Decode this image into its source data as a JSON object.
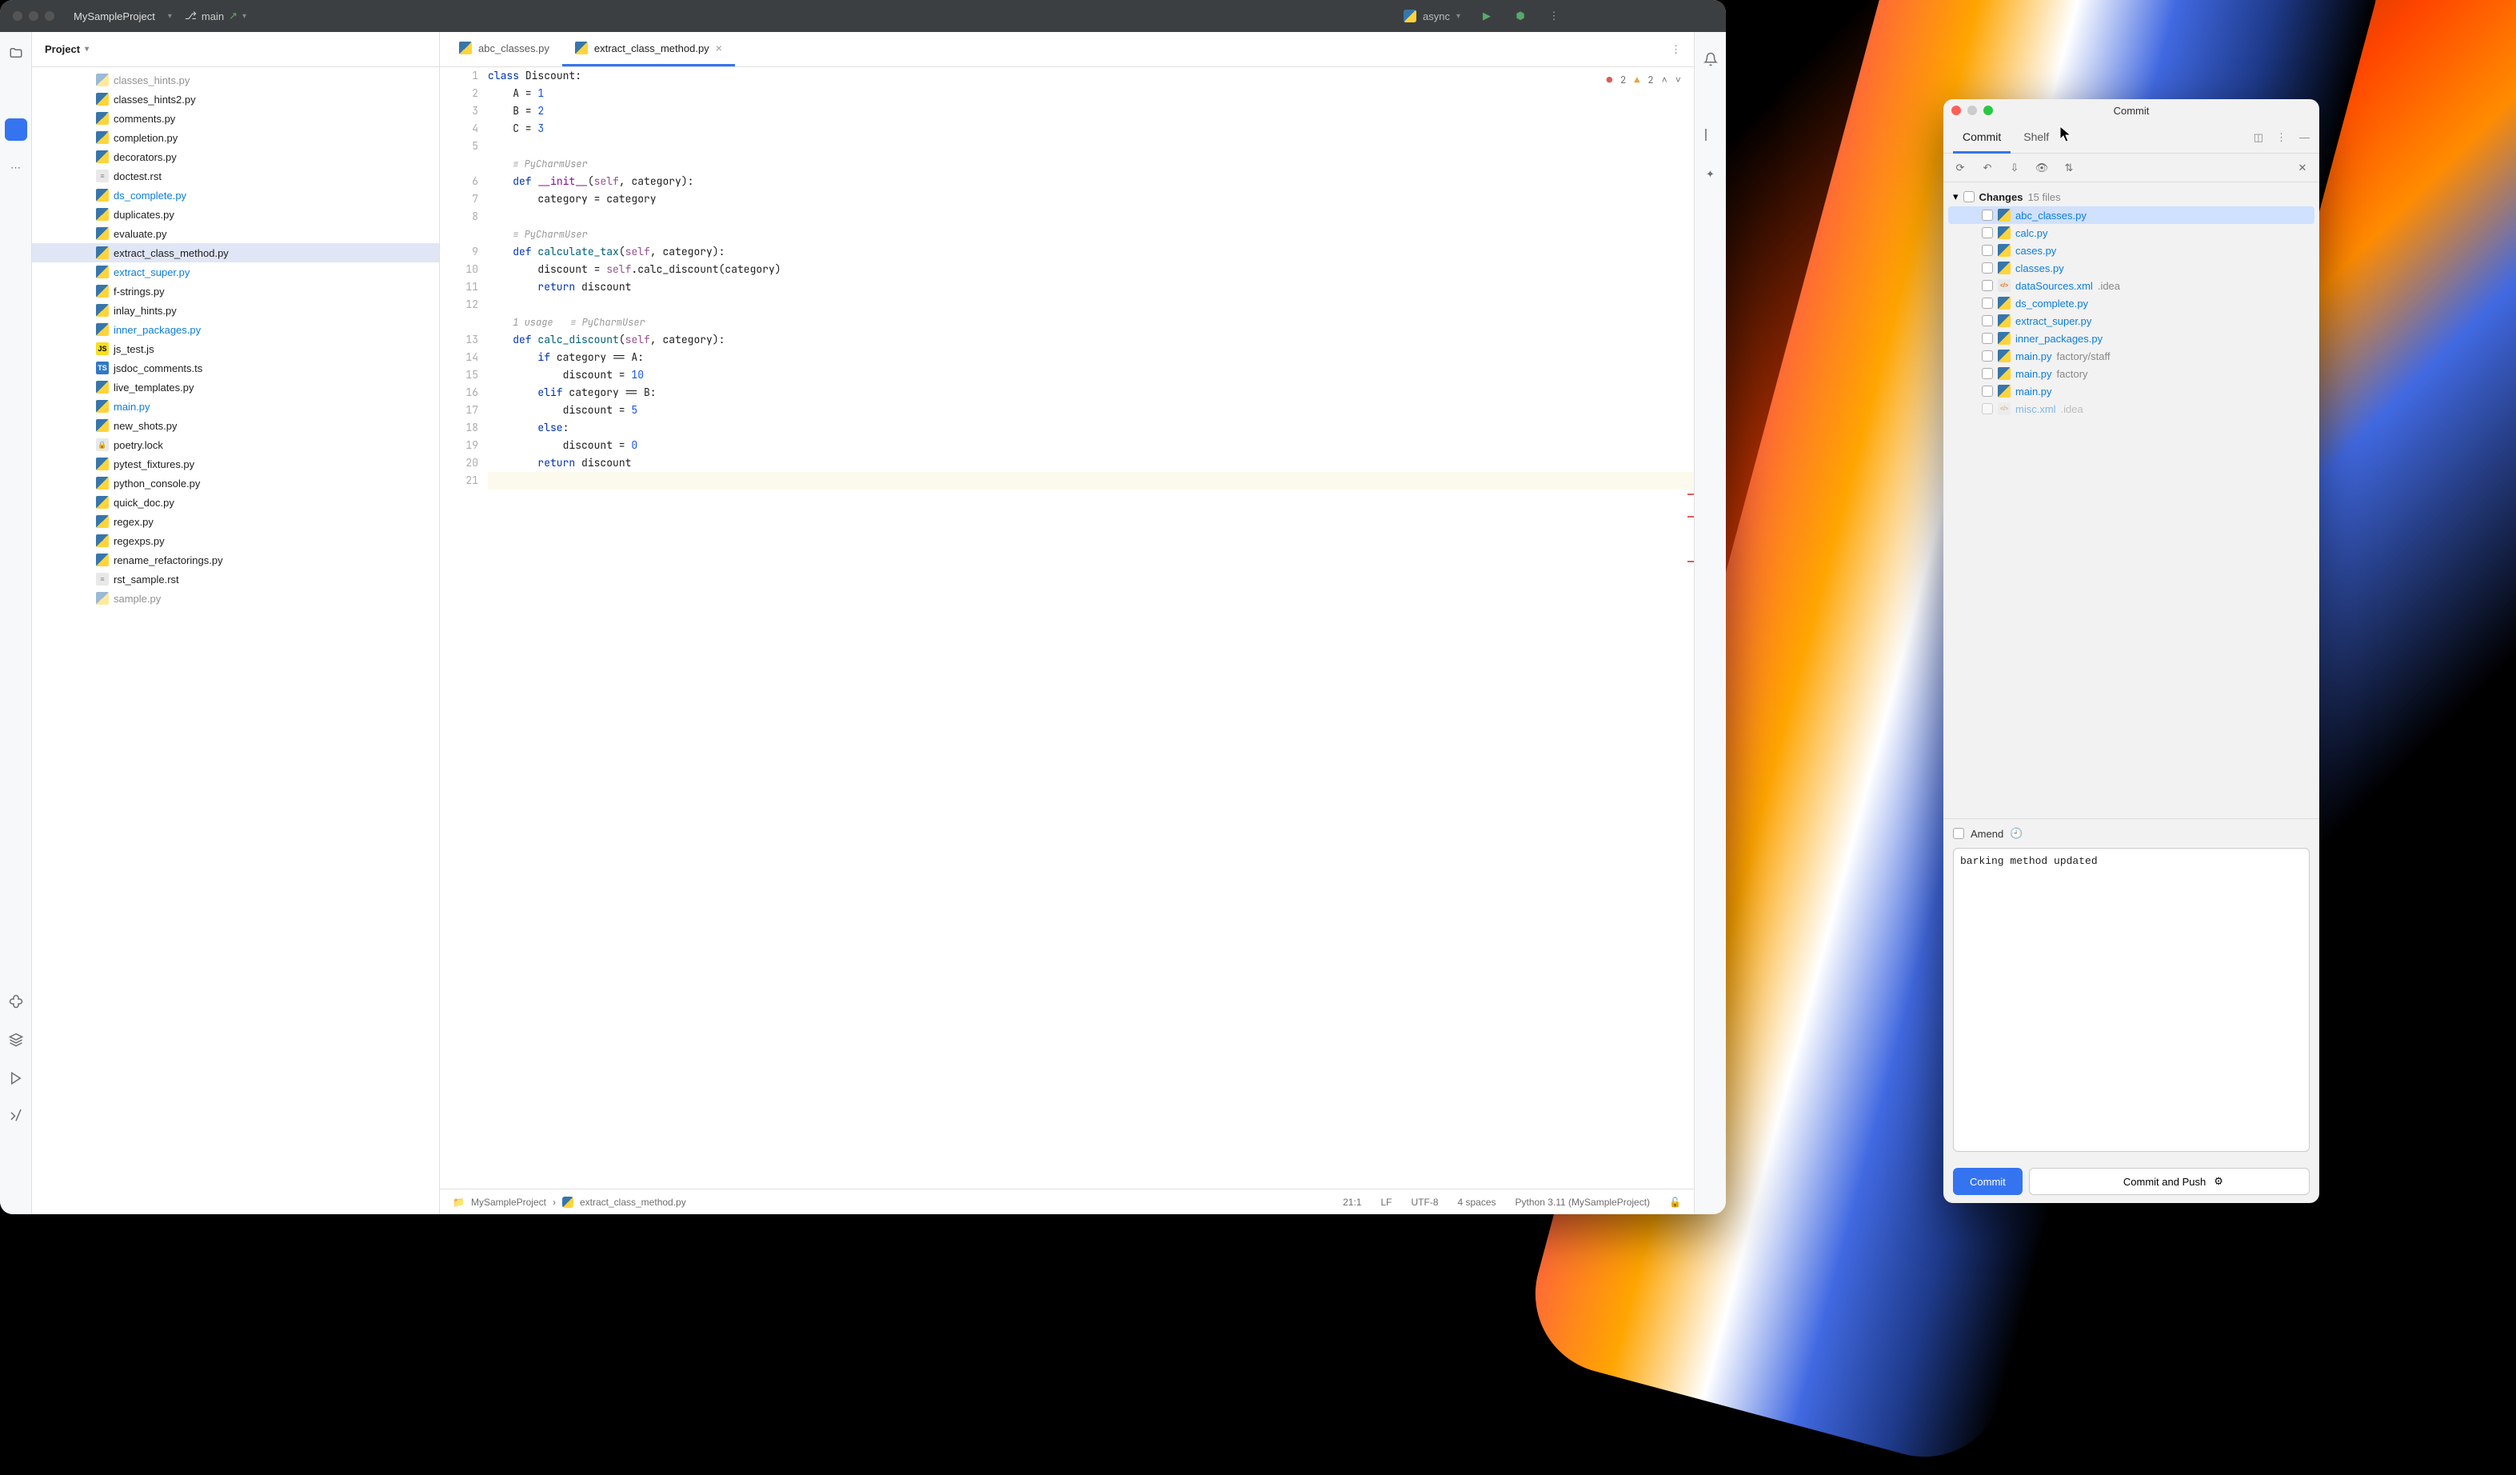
{
  "titlebar": {
    "project": "MySampleProject",
    "branch": "main",
    "run_config": "async"
  },
  "sidebar": {
    "title": "Project",
    "files": [
      {
        "n": "classes_hints.py",
        "icon": "py",
        "mod": false,
        "sel": false,
        "cut": true
      },
      {
        "n": "classes_hints2.py",
        "icon": "py",
        "mod": false,
        "sel": false
      },
      {
        "n": "comments.py",
        "icon": "py",
        "mod": false,
        "sel": false
      },
      {
        "n": "completion.py",
        "icon": "py",
        "mod": false,
        "sel": false
      },
      {
        "n": "decorators.py",
        "icon": "py",
        "mod": false,
        "sel": false
      },
      {
        "n": "doctest.rst",
        "icon": "rst",
        "mod": false,
        "sel": false
      },
      {
        "n": "ds_complete.py",
        "icon": "py",
        "mod": true,
        "sel": false
      },
      {
        "n": "duplicates.py",
        "icon": "py",
        "mod": false,
        "sel": false
      },
      {
        "n": "evaluate.py",
        "icon": "py",
        "mod": false,
        "sel": false
      },
      {
        "n": "extract_class_method.py",
        "icon": "py",
        "mod": false,
        "sel": true
      },
      {
        "n": "extract_super.py",
        "icon": "py",
        "mod": true,
        "sel": false
      },
      {
        "n": "f-strings.py",
        "icon": "py",
        "mod": false,
        "sel": false
      },
      {
        "n": "inlay_hints.py",
        "icon": "py",
        "mod": false,
        "sel": false
      },
      {
        "n": "inner_packages.py",
        "icon": "py",
        "mod": true,
        "sel": false
      },
      {
        "n": "js_test.js",
        "icon": "js",
        "mod": false,
        "sel": false
      },
      {
        "n": "jsdoc_comments.ts",
        "icon": "ts",
        "mod": false,
        "sel": false
      },
      {
        "n": "live_templates.py",
        "icon": "py",
        "mod": false,
        "sel": false
      },
      {
        "n": "main.py",
        "icon": "py",
        "mod": true,
        "sel": false
      },
      {
        "n": "new_shots.py",
        "icon": "py",
        "mod": false,
        "sel": false
      },
      {
        "n": "poetry.lock",
        "icon": "lock",
        "mod": false,
        "sel": false
      },
      {
        "n": "pytest_fixtures.py",
        "icon": "py",
        "mod": false,
        "sel": false
      },
      {
        "n": "python_console.py",
        "icon": "py",
        "mod": false,
        "sel": false
      },
      {
        "n": "quick_doc.py",
        "icon": "py",
        "mod": false,
        "sel": false
      },
      {
        "n": "regex.py",
        "icon": "py",
        "mod": false,
        "sel": false
      },
      {
        "n": "regexps.py",
        "icon": "py",
        "mod": false,
        "sel": false
      },
      {
        "n": "rename_refactorings.py",
        "icon": "py",
        "mod": false,
        "sel": false
      },
      {
        "n": "rst_sample.rst",
        "icon": "rst",
        "mod": false,
        "sel": false
      },
      {
        "n": "sample.py",
        "icon": "py",
        "mod": false,
        "sel": false,
        "cut": true
      }
    ]
  },
  "tabs": [
    {
      "label": "abc_classes.py",
      "active": false
    },
    {
      "label": "extract_class_method.py",
      "active": true
    }
  ],
  "problems": {
    "errors": "2",
    "warnings": "2"
  },
  "code": {
    "author": "PyCharmUser",
    "usages": "1 usage",
    "lines": [
      {
        "g": "1",
        "h": "<span class=kw>class</span> Discount:"
      },
      {
        "g": "2",
        "h": "    A = <span class=num>1</span>"
      },
      {
        "g": "3",
        "h": "    B = <span class=num>2</span>"
      },
      {
        "g": "4",
        "h": "    C = <span class=num>3</span>"
      },
      {
        "g": "5",
        "h": ""
      },
      {
        "g": "",
        "h": "    <span class=inlay>≡ PyCharmUser</span>"
      },
      {
        "g": "6",
        "h": "    <span class=kw>def</span> <span class=decl>__init__</span>(<span class=self>self</span>, category):"
      },
      {
        "g": "7",
        "h": "        category = category"
      },
      {
        "g": "8",
        "h": ""
      },
      {
        "g": "",
        "h": "    <span class=inlay>≡ PyCharmUser</span>"
      },
      {
        "g": "9",
        "h": "    <span class=kw>def</span> <span class=fn>calculate_tax</span>(<span class=self>self</span>, category):"
      },
      {
        "g": "10",
        "h": "        discount = <span class=self>self</span>.calc_discount(category)"
      },
      {
        "g": "11",
        "h": "        <span class=kw>return</span> discount"
      },
      {
        "g": "12",
        "h": ""
      },
      {
        "g": "",
        "h": "    <span class=inlay>1 usage   ≡ PyCharmUser</span>"
      },
      {
        "g": "13",
        "h": "    <span class=kw>def</span> <span class=fn>calc_discount</span>(<span class=self>self</span>, category):"
      },
      {
        "g": "14",
        "h": "        <span class=kw>if</span> category == A:"
      },
      {
        "g": "15",
        "h": "            discount = <span class=num>10</span>"
      },
      {
        "g": "16",
        "h": "        <span class=kw>elif</span> category == B:"
      },
      {
        "g": "17",
        "h": "            discount = <span class=num>5</span>"
      },
      {
        "g": "18",
        "h": "        <span class=kw>else</span>:"
      },
      {
        "g": "19",
        "h": "            discount = <span class=num>0</span>"
      },
      {
        "g": "20",
        "h": "        <span class=kw>return</span> discount"
      },
      {
        "g": "21",
        "h": "",
        "cur": true
      }
    ]
  },
  "status": {
    "crumb1": "MySampleProject",
    "crumb2": "extract_class_method.py",
    "pos": "21:1",
    "le": "LF",
    "enc": "UTF-8",
    "indent": "4 spaces",
    "sdk": "Python 3.11 (MySampleProject)"
  },
  "commit": {
    "title": "Commit",
    "tabs": {
      "commit": "Commit",
      "shelf": "Shelf"
    },
    "changes_label": "Changes",
    "changes_count": "15 files",
    "files": [
      {
        "n": "abc_classes.py",
        "icon": "py",
        "sel": true
      },
      {
        "n": "calc.py",
        "icon": "py"
      },
      {
        "n": "cases.py",
        "icon": "py"
      },
      {
        "n": "classes.py",
        "icon": "py"
      },
      {
        "n": "dataSources.xml",
        "icon": "xml",
        "path": ".idea"
      },
      {
        "n": "ds_complete.py",
        "icon": "py"
      },
      {
        "n": "extract_super.py",
        "icon": "py"
      },
      {
        "n": "inner_packages.py",
        "icon": "py"
      },
      {
        "n": "main.py",
        "icon": "py",
        "path": "factory/staff"
      },
      {
        "n": "main.py",
        "icon": "py",
        "path": "factory"
      },
      {
        "n": "main.py",
        "icon": "py"
      },
      {
        "n": "misc.xml",
        "icon": "xml",
        "path": ".idea",
        "cut": true
      }
    ],
    "amend": "Amend",
    "message": "barking method updated",
    "btn_commit": "Commit",
    "btn_push": "Commit and Push"
  }
}
